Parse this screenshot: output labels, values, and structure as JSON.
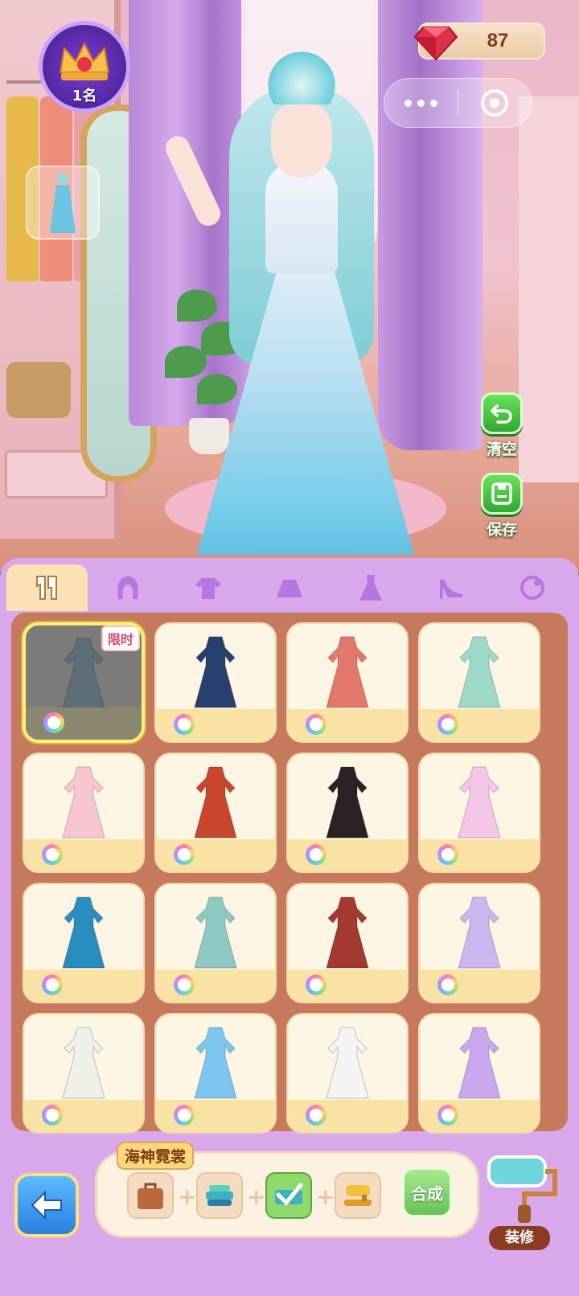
{
  "top_left": {
    "rank_label": "1名"
  },
  "currency": {
    "amount": "87",
    "gem_color": "#e0304a"
  },
  "capsule": {
    "more_icon": "more-dots-icon",
    "close_icon": "target-icon"
  },
  "side_buttons": [
    {
      "label": "清空",
      "icon": "undo-icon"
    },
    {
      "label": "保存",
      "icon": "save-icon"
    }
  ],
  "tabs": [
    {
      "id": "suit",
      "icon": "suit-icon",
      "active": true
    },
    {
      "id": "hair",
      "icon": "hair-icon",
      "active": false
    },
    {
      "id": "top",
      "icon": "top-icon",
      "active": false
    },
    {
      "id": "skirt",
      "icon": "skirt-icon",
      "active": false
    },
    {
      "id": "dress",
      "icon": "dress-icon",
      "active": false
    },
    {
      "id": "shoes",
      "icon": "heels-icon",
      "active": false
    },
    {
      "id": "accessory",
      "icon": "accessory-icon",
      "active": false
    }
  ],
  "grid": {
    "limited_tag": "限时",
    "items": [
      {
        "name": "sea-god-gown",
        "color": "#5e6e78",
        "selected": true,
        "limited": true
      },
      {
        "name": "overalls",
        "color": "#27406e"
      },
      {
        "name": "red-coat-dress",
        "color": "#e4786a"
      },
      {
        "name": "mint-qipao",
        "color": "#9ed9c7"
      },
      {
        "name": "pink-floral-gown",
        "color": "#f7c6d0"
      },
      {
        "name": "green-red-hanfu",
        "color": "#c8452e"
      },
      {
        "name": "black-robe",
        "color": "#2b2323"
      },
      {
        "name": "pink-romper",
        "color": "#f5c7e6"
      },
      {
        "name": "blue-ethnic-dress",
        "color": "#2a8dbf"
      },
      {
        "name": "teal-hanfu",
        "color": "#8dc9c2"
      },
      {
        "name": "red-ethnic-set",
        "color": "#a23a2d"
      },
      {
        "name": "lavender-gown",
        "color": "#cbb7ef"
      },
      {
        "name": "white-embroidered-dress",
        "color": "#eef1e8"
      },
      {
        "name": "blue-tulle-dress",
        "color": "#7cc6ef"
      },
      {
        "name": "polka-dot-dress",
        "color": "#f4f4f4"
      },
      {
        "name": "fairy-wing-gown",
        "color": "#c9a8ef"
      }
    ]
  },
  "synth": {
    "set_name": "海神霓裳",
    "button_label": "合成",
    "pieces": [
      {
        "icon": "bag-icon",
        "done": false
      },
      {
        "icon": "fabric-icon",
        "done": false
      },
      {
        "icon": "checked-fabric-icon",
        "done": true
      },
      {
        "icon": "sewing-machine-icon",
        "done": false
      }
    ]
  },
  "decorate": {
    "label": "装修"
  },
  "back": {
    "icon": "back-arrow-icon"
  }
}
